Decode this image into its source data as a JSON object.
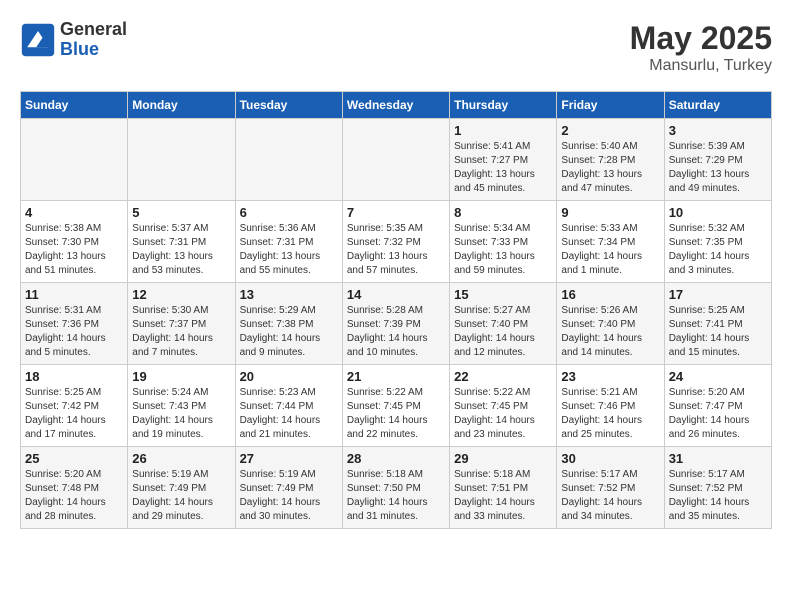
{
  "header": {
    "logo_general": "General",
    "logo_blue": "Blue",
    "month": "May 2025",
    "location": "Mansurlu, Turkey"
  },
  "weekdays": [
    "Sunday",
    "Monday",
    "Tuesday",
    "Wednesday",
    "Thursday",
    "Friday",
    "Saturday"
  ],
  "weeks": [
    [
      {
        "day": "",
        "info": ""
      },
      {
        "day": "",
        "info": ""
      },
      {
        "day": "",
        "info": ""
      },
      {
        "day": "",
        "info": ""
      },
      {
        "day": "1",
        "info": "Sunrise: 5:41 AM\nSunset: 7:27 PM\nDaylight: 13 hours\nand 45 minutes."
      },
      {
        "day": "2",
        "info": "Sunrise: 5:40 AM\nSunset: 7:28 PM\nDaylight: 13 hours\nand 47 minutes."
      },
      {
        "day": "3",
        "info": "Sunrise: 5:39 AM\nSunset: 7:29 PM\nDaylight: 13 hours\nand 49 minutes."
      }
    ],
    [
      {
        "day": "4",
        "info": "Sunrise: 5:38 AM\nSunset: 7:30 PM\nDaylight: 13 hours\nand 51 minutes."
      },
      {
        "day": "5",
        "info": "Sunrise: 5:37 AM\nSunset: 7:31 PM\nDaylight: 13 hours\nand 53 minutes."
      },
      {
        "day": "6",
        "info": "Sunrise: 5:36 AM\nSunset: 7:31 PM\nDaylight: 13 hours\nand 55 minutes."
      },
      {
        "day": "7",
        "info": "Sunrise: 5:35 AM\nSunset: 7:32 PM\nDaylight: 13 hours\nand 57 minutes."
      },
      {
        "day": "8",
        "info": "Sunrise: 5:34 AM\nSunset: 7:33 PM\nDaylight: 13 hours\nand 59 minutes."
      },
      {
        "day": "9",
        "info": "Sunrise: 5:33 AM\nSunset: 7:34 PM\nDaylight: 14 hours\nand 1 minute."
      },
      {
        "day": "10",
        "info": "Sunrise: 5:32 AM\nSunset: 7:35 PM\nDaylight: 14 hours\nand 3 minutes."
      }
    ],
    [
      {
        "day": "11",
        "info": "Sunrise: 5:31 AM\nSunset: 7:36 PM\nDaylight: 14 hours\nand 5 minutes."
      },
      {
        "day": "12",
        "info": "Sunrise: 5:30 AM\nSunset: 7:37 PM\nDaylight: 14 hours\nand 7 minutes."
      },
      {
        "day": "13",
        "info": "Sunrise: 5:29 AM\nSunset: 7:38 PM\nDaylight: 14 hours\nand 9 minutes."
      },
      {
        "day": "14",
        "info": "Sunrise: 5:28 AM\nSunset: 7:39 PM\nDaylight: 14 hours\nand 10 minutes."
      },
      {
        "day": "15",
        "info": "Sunrise: 5:27 AM\nSunset: 7:40 PM\nDaylight: 14 hours\nand 12 minutes."
      },
      {
        "day": "16",
        "info": "Sunrise: 5:26 AM\nSunset: 7:40 PM\nDaylight: 14 hours\nand 14 minutes."
      },
      {
        "day": "17",
        "info": "Sunrise: 5:25 AM\nSunset: 7:41 PM\nDaylight: 14 hours\nand 15 minutes."
      }
    ],
    [
      {
        "day": "18",
        "info": "Sunrise: 5:25 AM\nSunset: 7:42 PM\nDaylight: 14 hours\nand 17 minutes."
      },
      {
        "day": "19",
        "info": "Sunrise: 5:24 AM\nSunset: 7:43 PM\nDaylight: 14 hours\nand 19 minutes."
      },
      {
        "day": "20",
        "info": "Sunrise: 5:23 AM\nSunset: 7:44 PM\nDaylight: 14 hours\nand 21 minutes."
      },
      {
        "day": "21",
        "info": "Sunrise: 5:22 AM\nSunset: 7:45 PM\nDaylight: 14 hours\nand 22 minutes."
      },
      {
        "day": "22",
        "info": "Sunrise: 5:22 AM\nSunset: 7:45 PM\nDaylight: 14 hours\nand 23 minutes."
      },
      {
        "day": "23",
        "info": "Sunrise: 5:21 AM\nSunset: 7:46 PM\nDaylight: 14 hours\nand 25 minutes."
      },
      {
        "day": "24",
        "info": "Sunrise: 5:20 AM\nSunset: 7:47 PM\nDaylight: 14 hours\nand 26 minutes."
      }
    ],
    [
      {
        "day": "25",
        "info": "Sunrise: 5:20 AM\nSunset: 7:48 PM\nDaylight: 14 hours\nand 28 minutes."
      },
      {
        "day": "26",
        "info": "Sunrise: 5:19 AM\nSunset: 7:49 PM\nDaylight: 14 hours\nand 29 minutes."
      },
      {
        "day": "27",
        "info": "Sunrise: 5:19 AM\nSunset: 7:49 PM\nDaylight: 14 hours\nand 30 minutes."
      },
      {
        "day": "28",
        "info": "Sunrise: 5:18 AM\nSunset: 7:50 PM\nDaylight: 14 hours\nand 31 minutes."
      },
      {
        "day": "29",
        "info": "Sunrise: 5:18 AM\nSunset: 7:51 PM\nDaylight: 14 hours\nand 33 minutes."
      },
      {
        "day": "30",
        "info": "Sunrise: 5:17 AM\nSunset: 7:52 PM\nDaylight: 14 hours\nand 34 minutes."
      },
      {
        "day": "31",
        "info": "Sunrise: 5:17 AM\nSunset: 7:52 PM\nDaylight: 14 hours\nand 35 minutes."
      }
    ]
  ]
}
